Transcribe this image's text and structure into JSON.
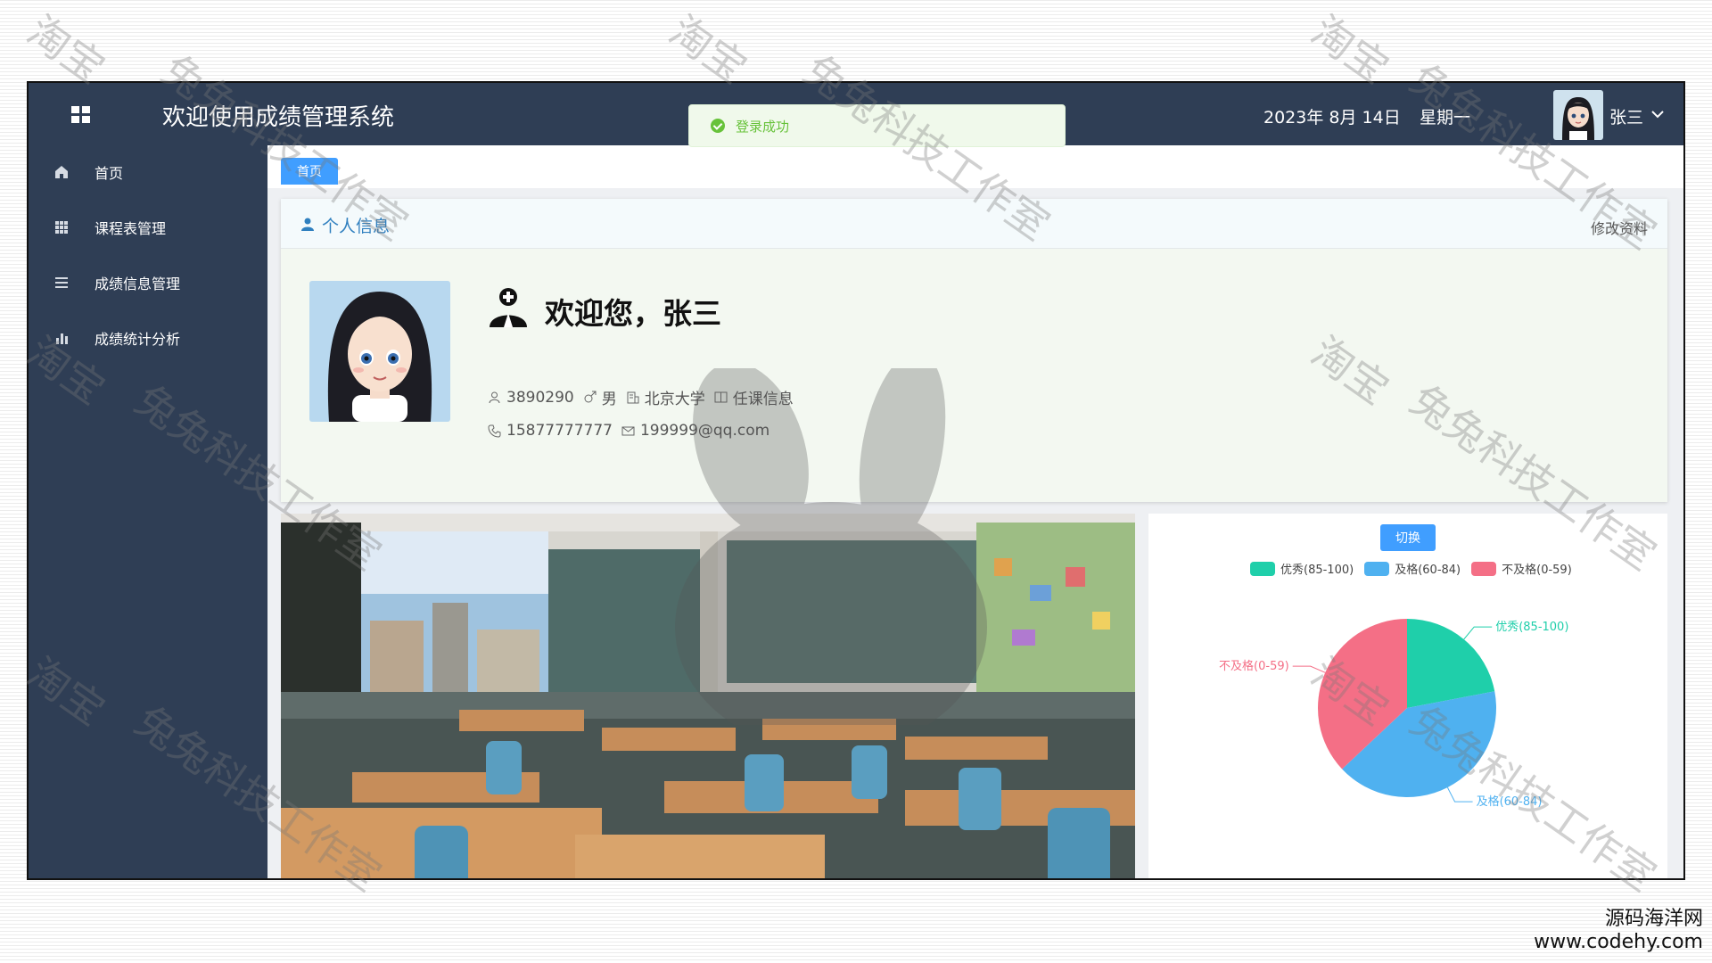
{
  "header": {
    "app_title": "欢迎使用成绩管理系统",
    "date": "2023年 8月 14日",
    "weekday": "星期一",
    "user_name": "张三"
  },
  "toast": {
    "message": "登录成功"
  },
  "sidebar": {
    "items": [
      {
        "label": "首页",
        "icon": "home-icon"
      },
      {
        "label": "课程表管理",
        "icon": "grid-icon"
      },
      {
        "label": "成绩信息管理",
        "icon": "list-icon"
      },
      {
        "label": "成绩统计分析",
        "icon": "bar-chart-icon"
      }
    ]
  },
  "tabs": {
    "home_label": "首页"
  },
  "profile": {
    "section_title": "个人信息",
    "edit_label": "修改资料",
    "welcome": "欢迎您，张三",
    "student_id": "3890290",
    "gender": "男",
    "school": "北京大学",
    "role": "任课信息",
    "phone": "15877777777",
    "email": "199999@qq.com"
  },
  "chart": {
    "switch_label": "切换"
  },
  "chart_data": {
    "type": "pie",
    "categories": [
      "优秀(85-100)",
      "及格(60-84)",
      "不及格(0-59)"
    ],
    "values": [
      22,
      41,
      37
    ],
    "colors": [
      "#1fcfaa",
      "#4fb1f0",
      "#f46f86"
    ],
    "legend": "top"
  },
  "watermarks": {
    "shop": "淘宝",
    "studio": "兔兔科技工作室"
  },
  "footer": {
    "site_name": "源码海洋网",
    "site_url": "www.codehy.com"
  }
}
